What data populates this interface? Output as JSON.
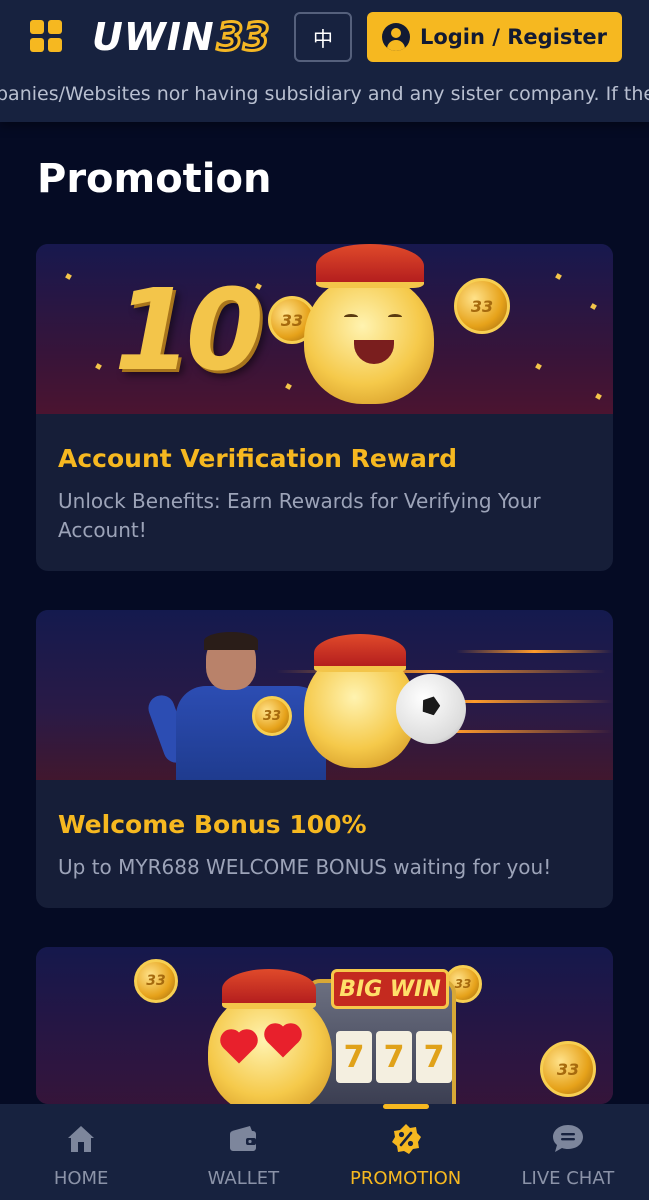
{
  "header": {
    "logo_text": "UWIN",
    "logo_number": "33",
    "lang_label": "中",
    "login_label": "Login / Register",
    "marquee_text": "panies/Websites nor having subsidiary and any sister company. If there would"
  },
  "main": {
    "title": "Promotion",
    "promotions": [
      {
        "title": "Account Verification Reward",
        "description": "Unlock Benefits: Earn Rewards for Verifying Your Account!",
        "banner_number": "10"
      },
      {
        "title": "Welcome Bonus 100%",
        "description": "Up to MYR688 WELCOME BONUS waiting for you!"
      },
      {
        "banner_sign": "BIG WIN",
        "reels": [
          "7",
          "7",
          "7"
        ]
      }
    ],
    "coin_label": "33"
  },
  "bottom_nav": {
    "items": [
      {
        "label": "HOME",
        "icon": "home-icon"
      },
      {
        "label": "WALLET",
        "icon": "wallet-icon"
      },
      {
        "label": "PROMOTION",
        "icon": "promotion-icon",
        "active": true
      },
      {
        "label": "LIVE CHAT",
        "icon": "chat-icon"
      }
    ]
  },
  "colors": {
    "accent": "#f6b820",
    "background": "#050b24",
    "card": "#161e38",
    "header": "#17223f"
  }
}
